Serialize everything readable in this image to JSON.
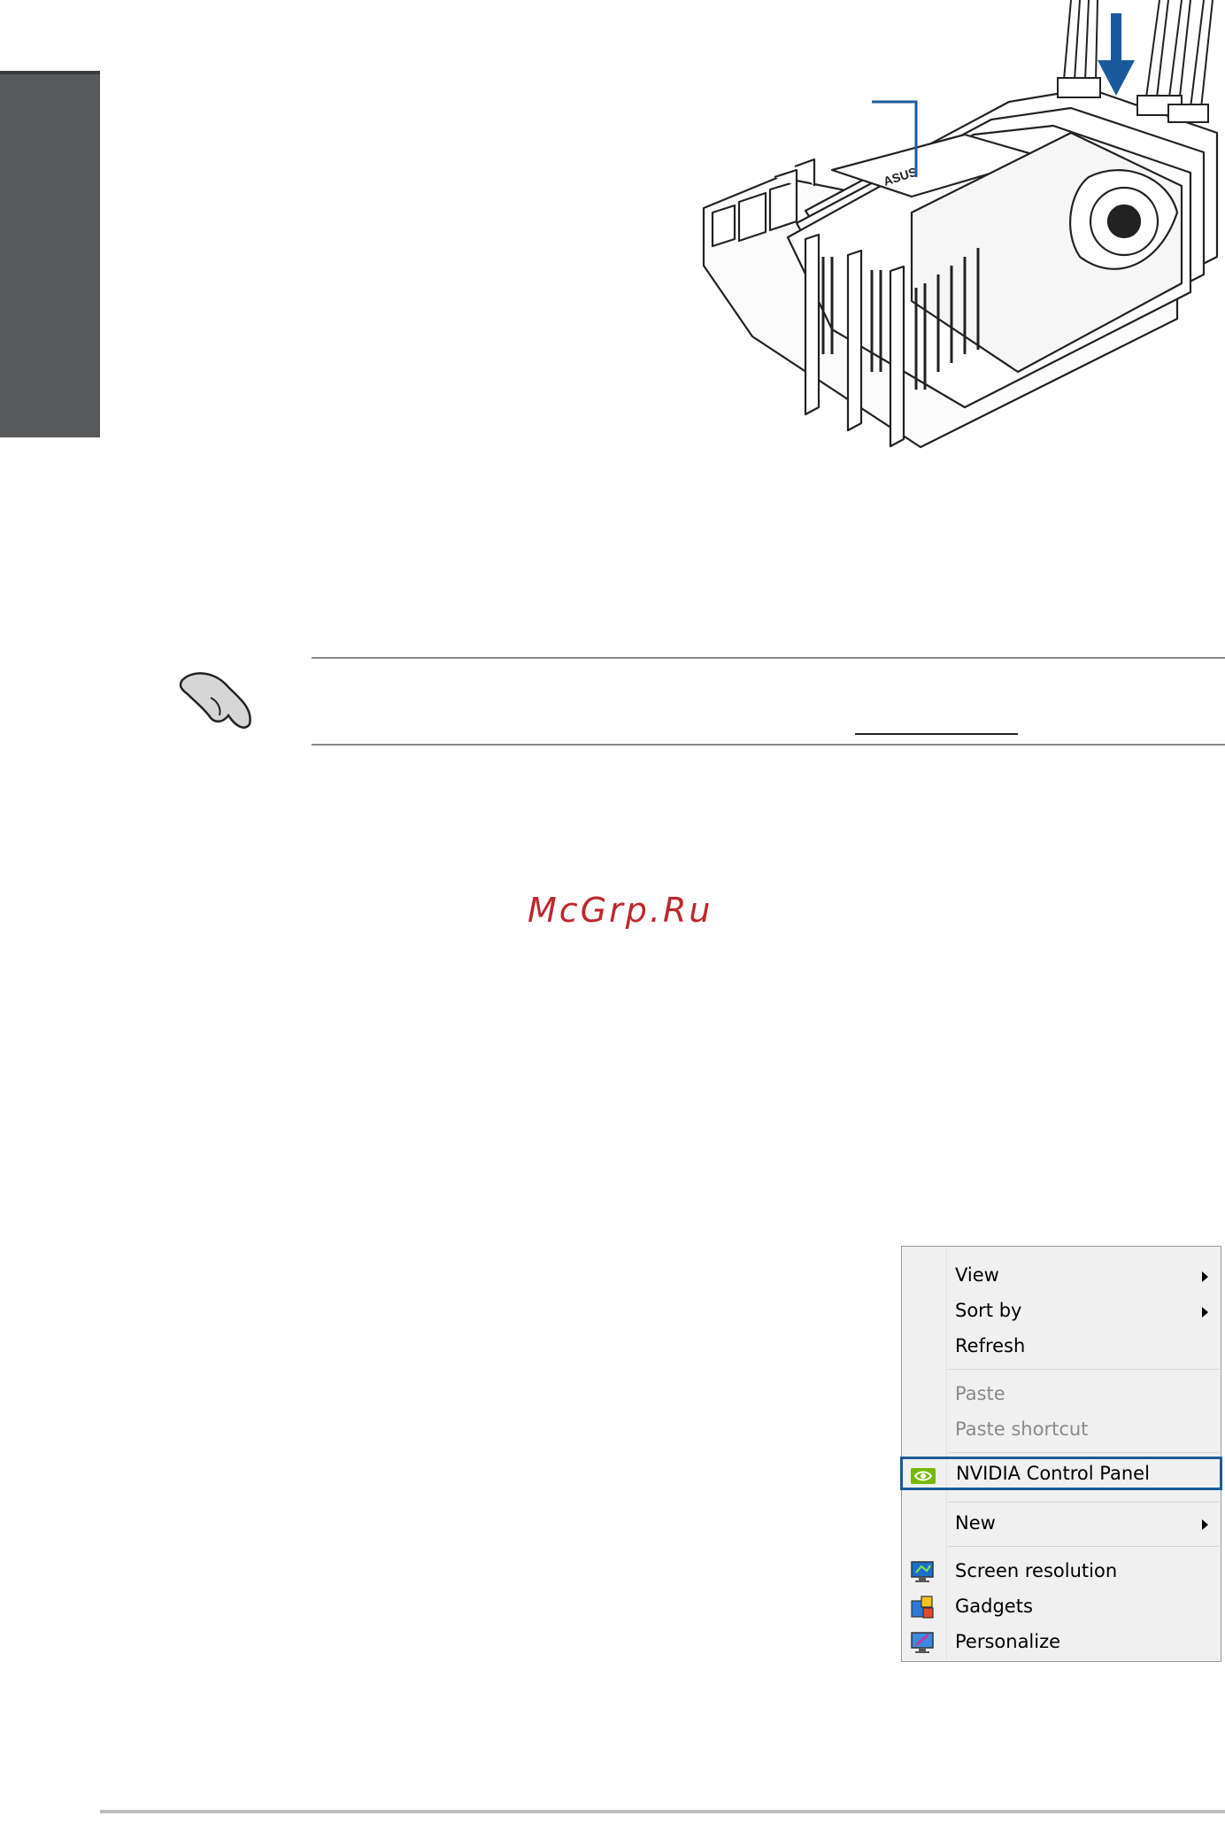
{
  "watermark": {
    "text": "McGrp.Ru",
    "color": "#c0262d"
  },
  "accent_color": "#1b5a9a",
  "illustration": {
    "description_icon": "graphics-cards-installation-icon",
    "brand_text": "ASUS"
  },
  "context_menu": {
    "items": [
      {
        "label": "View",
        "has_submenu": true,
        "enabled": true
      },
      {
        "label": "Sort by",
        "has_submenu": true,
        "enabled": true
      },
      {
        "label": "Refresh",
        "has_submenu": false,
        "enabled": true
      },
      {
        "label": "Paste",
        "has_submenu": false,
        "enabled": false
      },
      {
        "label": "Paste shortcut",
        "has_submenu": false,
        "enabled": false
      },
      {
        "label": "NVIDIA Control Panel",
        "has_submenu": false,
        "enabled": true,
        "highlighted": true,
        "icon": "nvidia-icon"
      },
      {
        "label": "New",
        "has_submenu": true,
        "enabled": true
      },
      {
        "label": "Screen resolution",
        "has_submenu": false,
        "enabled": true,
        "icon": "monitor-icon"
      },
      {
        "label": "Gadgets",
        "has_submenu": false,
        "enabled": true,
        "icon": "gadgets-icon"
      },
      {
        "label": "Personalize",
        "has_submenu": false,
        "enabled": true,
        "icon": "personalize-icon"
      }
    ]
  }
}
